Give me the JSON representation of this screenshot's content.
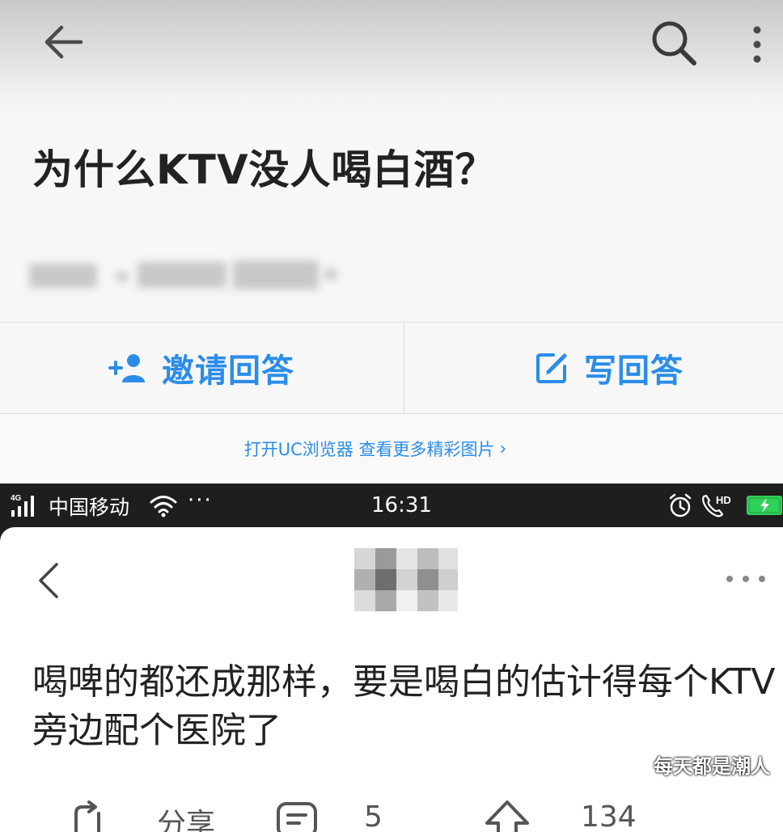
{
  "question_screen": {
    "title": "为什么KTV没人喝白酒？",
    "actions": {
      "invite_label": "邀请回答",
      "write_label": "写回答"
    },
    "uc_banner": "打开UC浏览器 查看更多精彩图片",
    "uc_chevron": "›"
  },
  "answer_screen": {
    "status_bar": {
      "network": "4G",
      "carrier": "中国移动",
      "dots": "···",
      "time": "16:31",
      "hd": "HD"
    },
    "answer_text": "喝啤的都还成那样，要是喝白的估计得每个KTV旁边配个医院了",
    "footer": {
      "share_label": "分享",
      "comment_count": "5",
      "like_count": "134"
    }
  },
  "watermark": "每天都是潮人",
  "colors": {
    "accent_blue": "#2b8de8",
    "battery_green": "#2fd158"
  },
  "icons": [
    "back-arrow-icon",
    "search-icon",
    "more-vertical-icon",
    "invite-person-icon",
    "edit-icon",
    "signal-icon",
    "wifi-icon",
    "alarm-icon",
    "hd-call-icon",
    "battery-icon",
    "chevron-left-icon",
    "more-horizontal-icon",
    "share-icon",
    "comment-icon",
    "like-icon"
  ]
}
